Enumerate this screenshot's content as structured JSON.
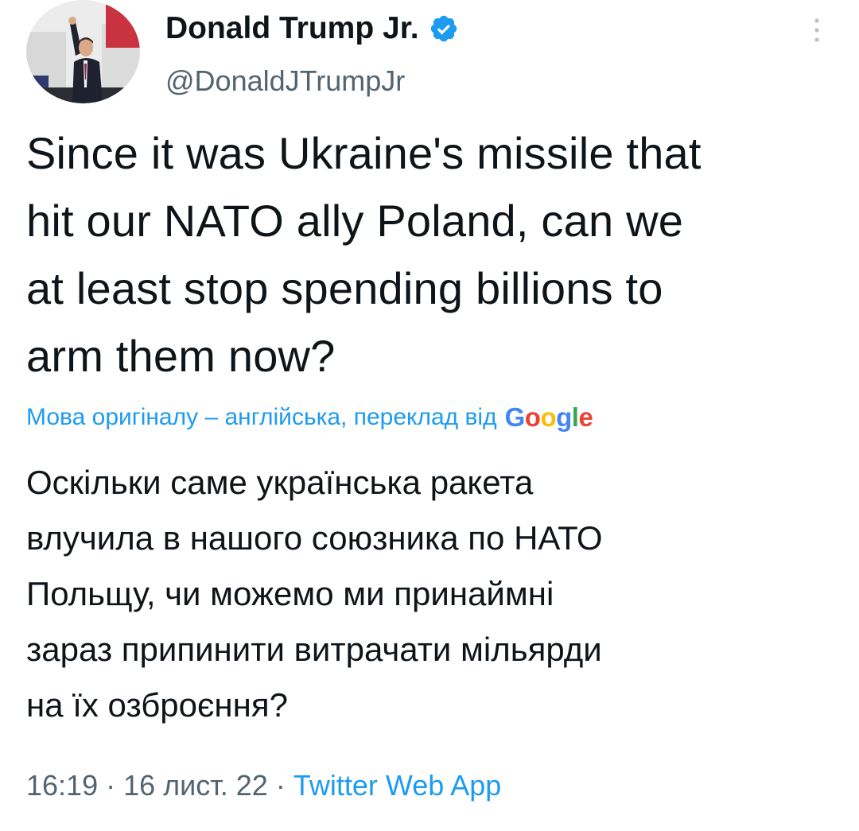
{
  "author": {
    "display_name": "Donald Trump Jr.",
    "handle": "@DonaldJTrumpJr",
    "verified": true
  },
  "tweet": {
    "text_lines": [
      "Since it was Ukraine's missile that",
      "hit our NATO ally Poland, can we",
      "at least stop spending billions to",
      "arm them now?"
    ]
  },
  "translation": {
    "label": "Мова оригіналу – англійська, переклад від",
    "provider": "Google",
    "text_lines": [
      "Оскільки саме українська ракета",
      "влучила в нашого союзника по НАТО",
      "Польщу, чи можемо ми принаймні",
      "зараз припинити витрачати мільярди",
      "на їх озброєння?"
    ]
  },
  "meta": {
    "time": "16:19",
    "date": "16 лист. 22",
    "source": "Twitter Web App",
    "separator": "·"
  },
  "colors": {
    "accent": "#1d9bf0",
    "text": "#0f1419",
    "muted": "#536471"
  },
  "icons": {
    "verified": "verified-badge-icon",
    "more": "more-options-icon"
  }
}
